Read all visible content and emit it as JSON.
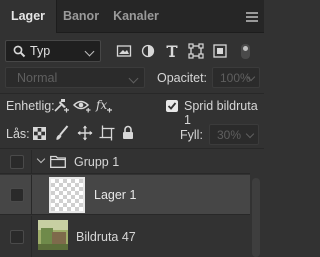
{
  "tabs": [
    {
      "label": "Lager",
      "active": true
    },
    {
      "label": "Banor",
      "active": false
    },
    {
      "label": "Kanaler",
      "active": false
    }
  ],
  "filter": {
    "kind_label": "Typ",
    "icons": [
      "pixel-filter-icon",
      "adjustment-filter-icon",
      "type-filter-icon",
      "shape-filter-icon",
      "smart-object-filter-icon"
    ]
  },
  "blend": {
    "mode": "Normal",
    "opacity_label": "Opacitet:",
    "opacity_value": "100%"
  },
  "unify": {
    "label": "Enhetlig:",
    "propagate_label": "Sprid bildruta 1",
    "propagate_checked": true
  },
  "lock": {
    "label": "Lås:",
    "fill_label": "Fyll:",
    "fill_value": "30%"
  },
  "layers": [
    {
      "name": "Grupp 1",
      "type": "group",
      "expanded": true
    },
    {
      "name": "Lager 1",
      "type": "layer",
      "selected": true
    },
    {
      "name": "Bildruta 47",
      "type": "image"
    }
  ],
  "colors": {
    "panel_bg": "#323232",
    "tab_bar_bg": "#262626",
    "selected_row": "#464646"
  }
}
